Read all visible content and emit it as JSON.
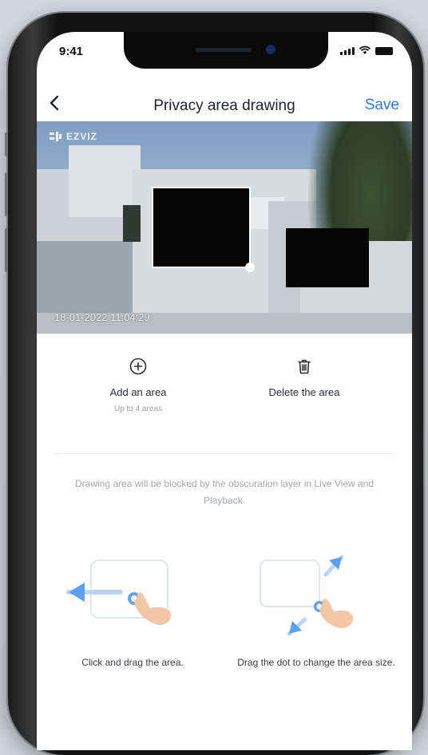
{
  "status": {
    "time": "9:41"
  },
  "nav": {
    "title": "Privacy area drawing",
    "save_label": "Save",
    "back_icon": "chevron-left-icon"
  },
  "camera": {
    "brand": "EZVIZ",
    "timestamp": "18-01-2022 11:04:29"
  },
  "actions": {
    "add": {
      "label": "Add an area",
      "sub": "Up to 4 areas",
      "icon": "plus-circle-icon"
    },
    "delete": {
      "label": "Delete the area",
      "icon": "trash-icon"
    }
  },
  "info": "Drawing area will be blocked by the obscuration layer in Live View and Playback.",
  "guides": [
    {
      "caption": "Click and drag the area.",
      "icon": "drag-area-illustration"
    },
    {
      "caption": "Drag the dot to change the area size.",
      "icon": "resize-area-illustration"
    }
  ],
  "colors": {
    "accent": "#2f7bd9",
    "mask": "#050505",
    "background": "#ffffff"
  }
}
